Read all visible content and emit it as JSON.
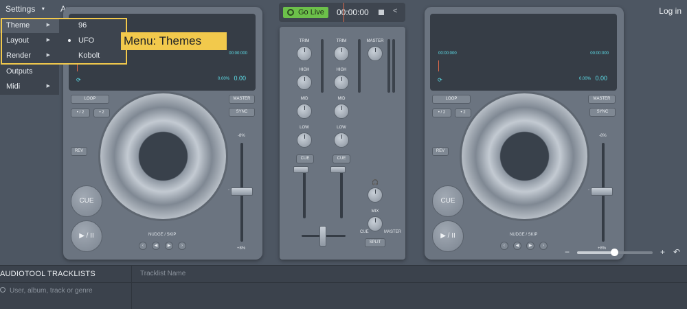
{
  "topbar": {
    "settings_label": "Settings",
    "app_label": "App",
    "login_label": "Log in",
    "caret": "▼"
  },
  "live": {
    "go_live_label": "Go Live",
    "timer": "00:00:00"
  },
  "settings_menu": {
    "items": [
      {
        "label": "Theme",
        "has_sub": true
      },
      {
        "label": "Layout",
        "has_sub": true
      },
      {
        "label": "Render",
        "has_sub": true
      },
      {
        "label": "Outputs",
        "has_sub": false
      },
      {
        "label": "Midi",
        "has_sub": true
      }
    ],
    "arrow": "▶"
  },
  "theme_submenu": {
    "items": [
      "96",
      "UFO",
      "Kobolt"
    ],
    "selected": "UFO"
  },
  "annotation": {
    "tooltip": "Menu: Themes"
  },
  "deck": {
    "screen_time_left": "00:00:000",
    "screen_time_right": "00:00:000",
    "pitch_percent": "0.00%",
    "pitch_value": "0.00",
    "loop_label": "LOOP",
    "master_label": "MASTER",
    "sync_label": "SYNC",
    "half_label": "• / 2",
    "double_label": "• 2",
    "rev_label": "REV",
    "cue_label": "CUE",
    "play_label": "▶ / II",
    "nudge_label": "NUDGE / SKIP",
    "pitch_top": "-8%",
    "pitch_bottom": "+8%",
    "pitch_mark": "-"
  },
  "mixer": {
    "trim": "TRIM",
    "high": "HIGH",
    "mid": "MID",
    "low": "LOW",
    "master": "MASTER",
    "cue": "CUE",
    "headphone": "🎧",
    "mix": "MIX",
    "mix_cue": "CUE",
    "mix_master": "MASTER",
    "split": "SPLIT"
  },
  "zoom": {
    "minus": "−",
    "plus": "+",
    "undo": "↶",
    "level": 0.45
  },
  "tracklists": {
    "title": "AUDIOTOOL TRACKLISTS",
    "column_name": "Tracklist Name",
    "search_placeholder": "User, album, track or genre"
  },
  "colors": {
    "accent_green": "#6cc04a",
    "highlight_yellow": "#f2c94c",
    "screen_cyan": "#5fe3ee",
    "marker_red": "#e36a4a"
  }
}
